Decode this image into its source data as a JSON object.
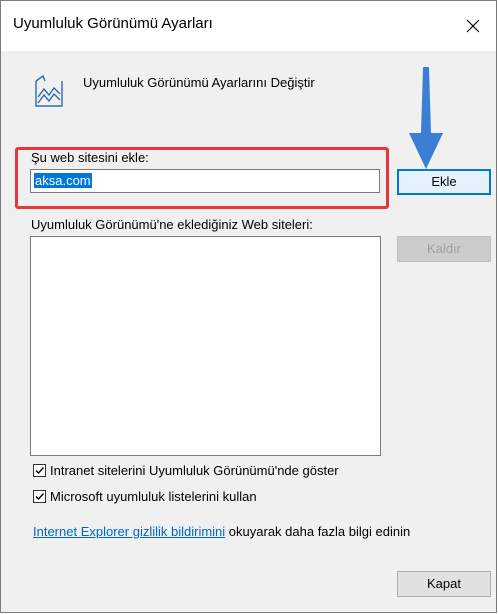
{
  "dialog": {
    "title": "Uyumluluk Görünümü Ayarları",
    "close_glyph": "✕"
  },
  "header": {
    "icon": "compat-view-icon",
    "text": "Uyumluluk Görünümü Ayarlarını Değiştir"
  },
  "add_section": {
    "label": "Şu web sitesini ekle:",
    "input_value": "aksa.com",
    "add_button": "Ekle"
  },
  "list_section": {
    "label": "Uyumluluk Görünümü'ne eklediğiniz Web siteleri:",
    "items": [],
    "remove_button": "Kaldır"
  },
  "options": [
    {
      "label": "Intranet sitelerini Uyumluluk Görünümü'nde göster",
      "checked": true
    },
    {
      "label": "Microsoft uyumluluk listelerini kullan",
      "checked": true
    }
  ],
  "privacy": {
    "link_text": "Internet Explorer gizlilik bildirimini",
    "suffix_text": " okuyarak daha fazla bilgi edinin"
  },
  "footer": {
    "close_button": "Kapat"
  },
  "colors": {
    "highlight": "#e5383b",
    "arrow": "#3b7fd4",
    "selection": "#0078d7",
    "link": "#0066cc"
  }
}
